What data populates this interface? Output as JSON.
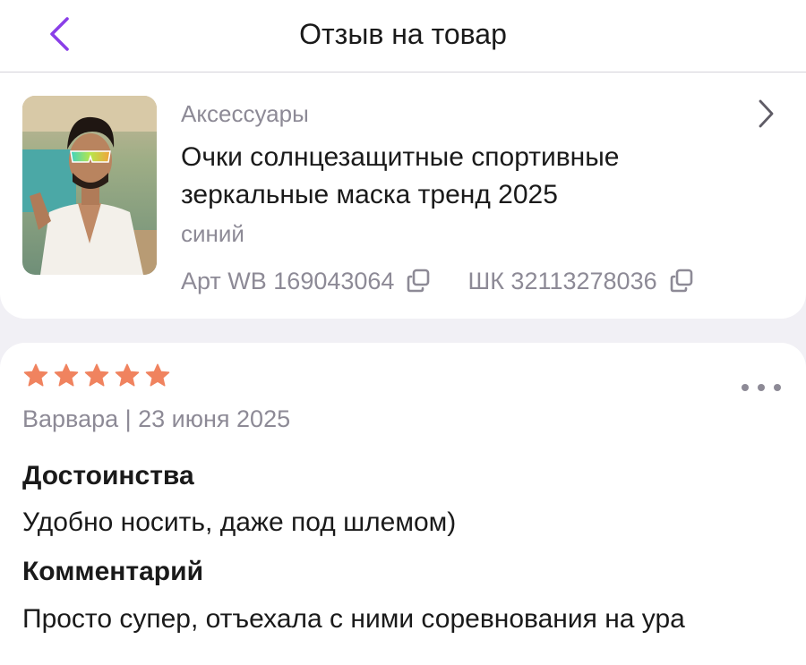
{
  "header": {
    "title": "Отзыв на товар",
    "back_icon": "chevron-left-icon",
    "accent_color": "#8a3fe8"
  },
  "product": {
    "category": "Аксессуары",
    "title": "Очки солнцезащитные спортивные зеркальные маска тренд 2025",
    "variant": "синий",
    "article_label": "Арт WB 169043064",
    "barcode_label": "ШК 32113278036",
    "copy_icon": "copy-icon",
    "open_icon": "chevron-right-icon",
    "image": "product-photo-man-in-sunglasses"
  },
  "review": {
    "rating": 5,
    "rating_max": 5,
    "star_color": "#f0835f",
    "author_date": "Варвара | 23 июня 2025",
    "more_icon": "more-horizontal-icon",
    "pros_label": "Достоинства",
    "pros_text": "Удобно носить, даже под шлемом)",
    "comment_label": "Комментарий",
    "comment_text": "Просто супер, отъехала с ними соревнования на ура"
  }
}
